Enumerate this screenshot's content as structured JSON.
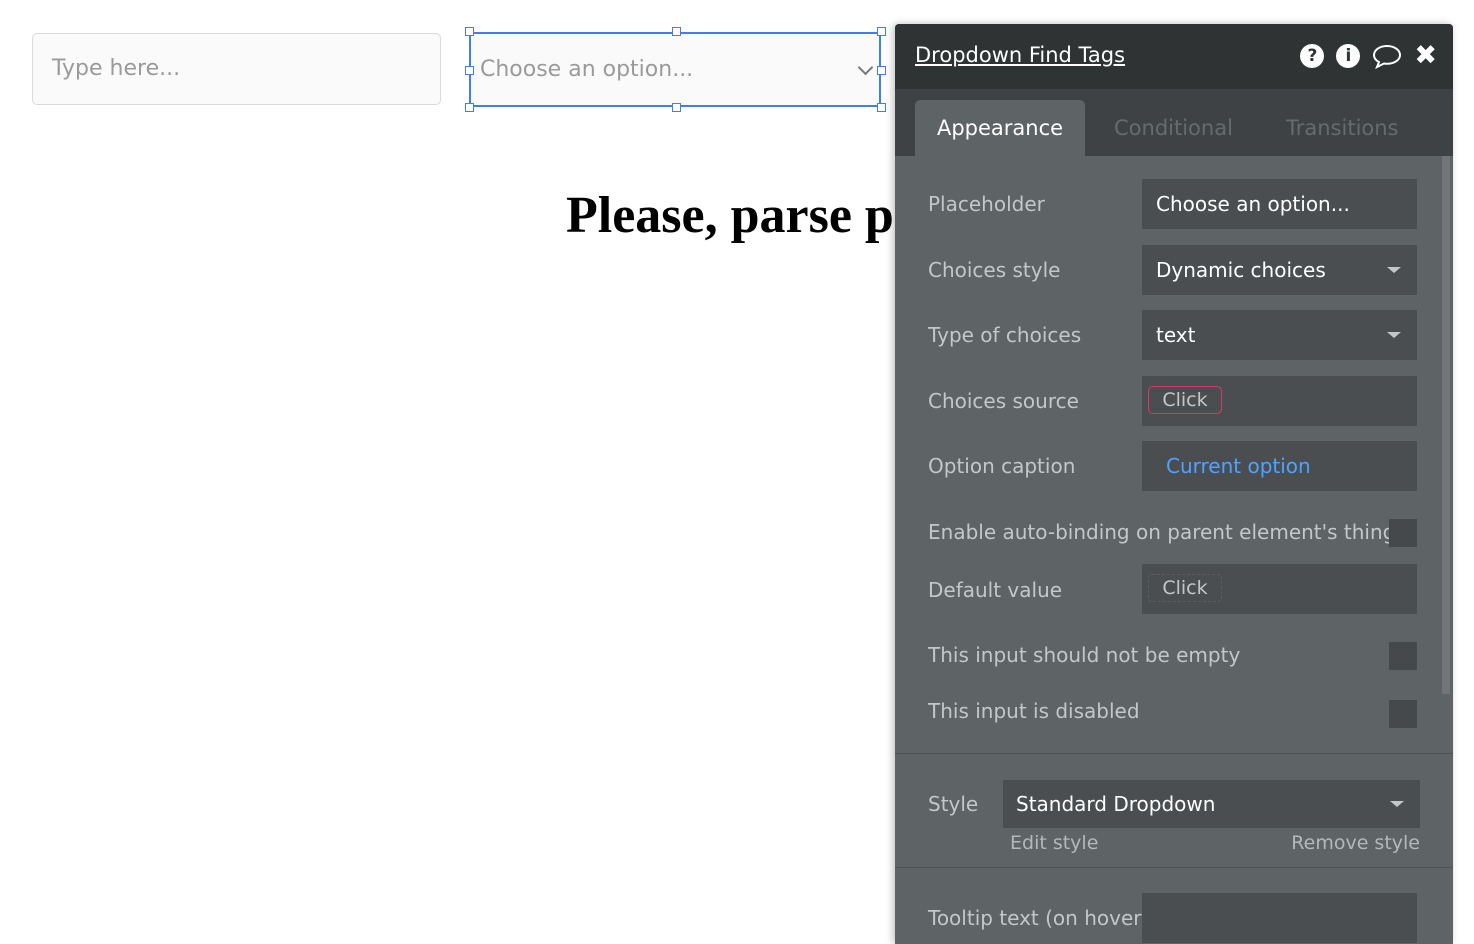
{
  "canvas": {
    "text_input_placeholder": "Type here...",
    "dropdown_placeholder": "Choose an option...",
    "heading_text": "Please, parse p"
  },
  "panel": {
    "title": "Dropdown Find Tags",
    "header_icons": [
      "help-icon",
      "info-icon",
      "comment-icon",
      "close-icon"
    ],
    "tabs": [
      {
        "label": "Appearance",
        "active": true
      },
      {
        "label": "Conditional",
        "active": false
      },
      {
        "label": "Transitions",
        "active": false
      }
    ],
    "fields": {
      "placeholder": {
        "label": "Placeholder",
        "value": "Choose an option..."
      },
      "choices_style": {
        "label": "Choices style",
        "value": "Dynamic choices"
      },
      "type_of_choices": {
        "label": "Type of choices",
        "value": "text"
      },
      "choices_source": {
        "label": "Choices source",
        "value": "Click"
      },
      "option_caption": {
        "label": "Option caption",
        "value": "Current option"
      },
      "auto_binding": {
        "label": "Enable auto-binding on parent element's thing",
        "checked": false
      },
      "default_value": {
        "label": "Default value",
        "value": "Click"
      },
      "not_empty": {
        "label": "This input should not be empty",
        "checked": false
      },
      "disabled": {
        "label": "This input is disabled",
        "checked": false
      },
      "style": {
        "label": "Style",
        "value": "Standard Dropdown",
        "edit_link": "Edit style",
        "remove_link": "Remove style"
      },
      "tooltip": {
        "label": "Tooltip text (on hover)",
        "value": ""
      }
    }
  },
  "colors": {
    "selection_blue": "#3d7ff0",
    "panel_bg": "#5e6366",
    "header_bg": "#2f3334",
    "error_red": "#d63a5e",
    "link_blue": "#4da3ff"
  }
}
